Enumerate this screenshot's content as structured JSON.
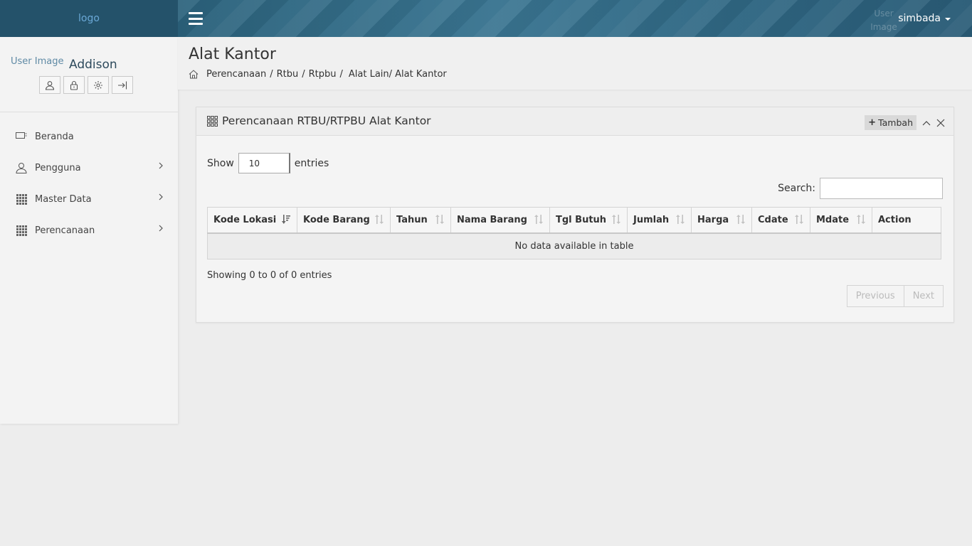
{
  "topbar": {
    "logo": "logo",
    "user_image_alt": "User Image",
    "username": "simbada"
  },
  "sidebar": {
    "profile": {
      "image_alt": "User Image",
      "name": "Addison"
    },
    "items": [
      {
        "label": "Beranda",
        "icon": "monitor-icon",
        "has_submenu": false
      },
      {
        "label": "Pengguna",
        "icon": "user-icon",
        "has_submenu": true
      },
      {
        "label": "Master Data",
        "icon": "grid-icon",
        "has_submenu": true
      },
      {
        "label": "Perencanaan",
        "icon": "grid-icon",
        "has_submenu": true
      }
    ]
  },
  "page": {
    "title": "Alat Kantor",
    "breadcrumb": {
      "part1": "Perencanaan",
      "sep1": "/",
      "part2": "Rtbu",
      "sep2": "/",
      "part3": "Rtpbu",
      "sep3": "/",
      "part4": "Alat Lain/ Alat Kantor"
    }
  },
  "panel": {
    "title": "Perencanaan RTBU/RTPBU Alat Kantor",
    "add_button": "Tambah"
  },
  "table": {
    "length_label_before": "Show",
    "length_value": "10",
    "length_label_after": "entries",
    "search_label": "Search:",
    "search_value": "",
    "columns": [
      "Kode Lokasi",
      "Kode Barang",
      "Tahun",
      "Nama Barang",
      "Tgl Butuh",
      "Jumlah",
      "Harga",
      "Cdate",
      "Mdate",
      "Action"
    ],
    "empty_text": "No data available in table",
    "info": "Showing 0 to 0 of 0 entries",
    "prev": "Previous",
    "next": "Next"
  },
  "colors": {
    "brand_bg": "#24526a",
    "navbar_bg": "#3a7591",
    "sidebar_bg": "#f3f3f3",
    "content_bg": "#ededed"
  }
}
